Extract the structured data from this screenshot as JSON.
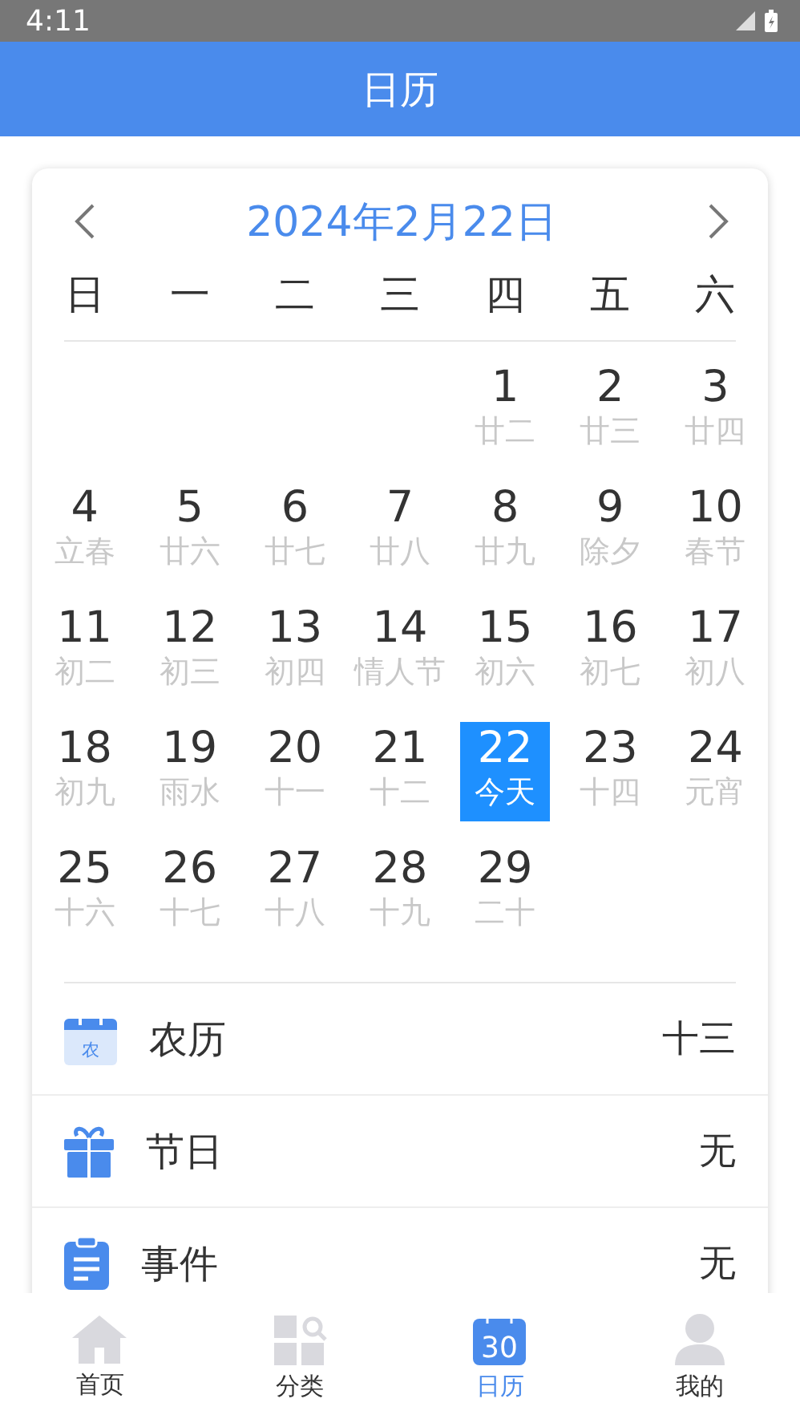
{
  "status_bar": {
    "time": "4:11"
  },
  "app_bar": {
    "title": "日历"
  },
  "calendar": {
    "month_title": "2024年2月22日",
    "weekdays": [
      "日",
      "一",
      "二",
      "三",
      "四",
      "五",
      "六"
    ],
    "weeks": [
      [
        {
          "kind": "blank"
        },
        {
          "kind": "blank"
        },
        {
          "kind": "blank"
        },
        {
          "kind": "blank"
        },
        {
          "kind": "day",
          "day": "1",
          "lunar": "廿二",
          "selected": false
        },
        {
          "kind": "day",
          "day": "2",
          "lunar": "廿三",
          "selected": false
        },
        {
          "kind": "day",
          "day": "3",
          "lunar": "廿四",
          "selected": false
        }
      ],
      [
        {
          "kind": "day",
          "day": "4",
          "lunar": "立春",
          "selected": false
        },
        {
          "kind": "day",
          "day": "5",
          "lunar": "廿六",
          "selected": false
        },
        {
          "kind": "day",
          "day": "6",
          "lunar": "廿七",
          "selected": false
        },
        {
          "kind": "day",
          "day": "7",
          "lunar": "廿八",
          "selected": false
        },
        {
          "kind": "day",
          "day": "8",
          "lunar": "廿九",
          "selected": false
        },
        {
          "kind": "day",
          "day": "9",
          "lunar": "除夕",
          "selected": false
        },
        {
          "kind": "day",
          "day": "10",
          "lunar": "春节",
          "selected": false
        }
      ],
      [
        {
          "kind": "day",
          "day": "11",
          "lunar": "初二",
          "selected": false
        },
        {
          "kind": "day",
          "day": "12",
          "lunar": "初三",
          "selected": false
        },
        {
          "kind": "day",
          "day": "13",
          "lunar": "初四",
          "selected": false
        },
        {
          "kind": "day",
          "day": "14",
          "lunar": "情人节",
          "selected": false
        },
        {
          "kind": "day",
          "day": "15",
          "lunar": "初六",
          "selected": false
        },
        {
          "kind": "day",
          "day": "16",
          "lunar": "初七",
          "selected": false
        },
        {
          "kind": "day",
          "day": "17",
          "lunar": "初八",
          "selected": false
        }
      ],
      [
        {
          "kind": "day",
          "day": "18",
          "lunar": "初九",
          "selected": false
        },
        {
          "kind": "day",
          "day": "19",
          "lunar": "雨水",
          "selected": false
        },
        {
          "kind": "day",
          "day": "20",
          "lunar": "十一",
          "selected": false
        },
        {
          "kind": "day",
          "day": "21",
          "lunar": "十二",
          "selected": false
        },
        {
          "kind": "day",
          "day": "22",
          "lunar": "今天",
          "selected": true
        },
        {
          "kind": "day",
          "day": "23",
          "lunar": "十四",
          "selected": false
        },
        {
          "kind": "day",
          "day": "24",
          "lunar": "元宵",
          "selected": false
        }
      ],
      [
        {
          "kind": "day",
          "day": "25",
          "lunar": "十六",
          "selected": false
        },
        {
          "kind": "day",
          "day": "26",
          "lunar": "十七",
          "selected": false
        },
        {
          "kind": "day",
          "day": "27",
          "lunar": "十八",
          "selected": false
        },
        {
          "kind": "day",
          "day": "28",
          "lunar": "十九",
          "selected": false
        },
        {
          "kind": "day",
          "day": "29",
          "lunar": "二十",
          "selected": false
        },
        {
          "kind": "blank"
        },
        {
          "kind": "blank"
        }
      ]
    ]
  },
  "details": [
    {
      "kind": "lunar",
      "label": "农历",
      "icon_text": "农",
      "value": "十三"
    },
    {
      "kind": "festival",
      "label": "节日",
      "value": "无"
    },
    {
      "kind": "event",
      "label": "事件",
      "value": "无"
    }
  ],
  "bottom_nav": [
    {
      "kind": "home",
      "label": "首页",
      "selected": false
    },
    {
      "kind": "category",
      "label": "分类",
      "selected": false
    },
    {
      "kind": "calendar",
      "label": "日历",
      "icon_text": "30",
      "selected": true
    },
    {
      "kind": "profile",
      "label": "我的",
      "selected": false
    }
  ]
}
